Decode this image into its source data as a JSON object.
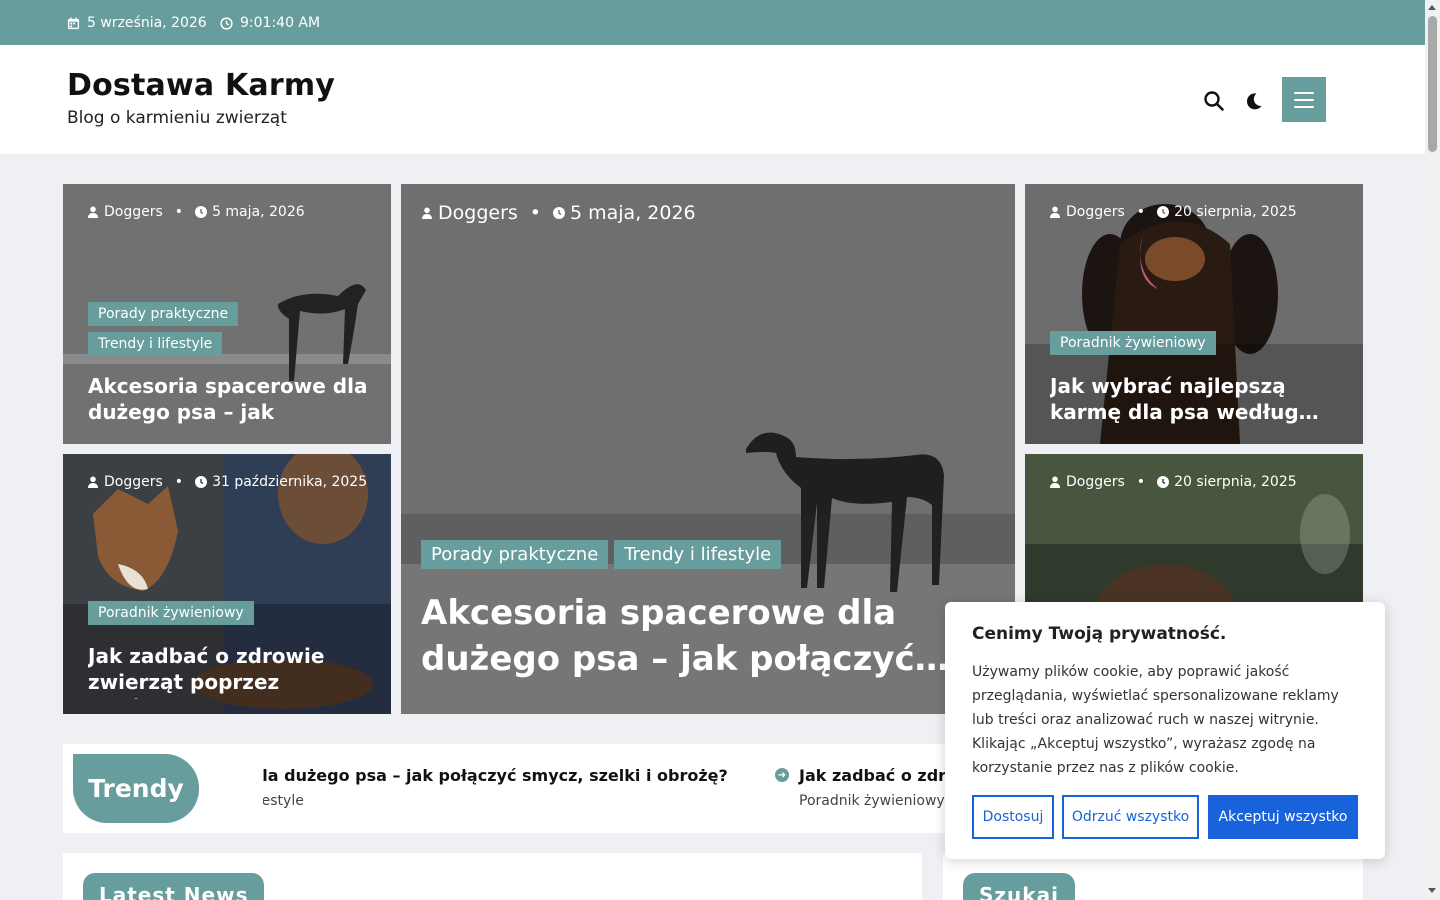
{
  "topbar": {
    "date": "5 września, 2026",
    "time": "9:01:40 AM",
    "icons": [
      "calendar-icon",
      "clock-icon"
    ]
  },
  "header": {
    "site_title": "Dostawa Karmy",
    "tagline": "Blog o karmieniu zwierząt"
  },
  "colors": {
    "accent": "#689d9e",
    "cookie_blue": "#1863dc"
  },
  "cards": [
    {
      "author": "Doggers",
      "date": "5 maja, 2026",
      "cats": [
        "Porady praktyczne",
        "Trendy i lifestyle"
      ],
      "title": "Akcesoria spacerowe dla dużego psa – jak połączy…"
    },
    {
      "author": "Doggers",
      "date": "31 października, 2025",
      "cats": [
        "Poradnik żywieniowy"
      ],
      "title": "Jak zadbać o zdrowie zwierząt poprzez właściw…"
    },
    {
      "author": "Doggers",
      "date": "5 maja, 2026",
      "cats": [
        "Porady praktyczne",
        "Trendy i lifestyle"
      ],
      "title": "Akcesoria spacerowe dla dużego psa – jak połączyć…"
    },
    {
      "author": "Doggers",
      "date": "20 sierpnia, 2025",
      "cats": [
        "Poradnik żywieniowy"
      ],
      "title": "Jak wybrać najlepszą karmę dla psa według…"
    },
    {
      "author": "Doggers",
      "date": "20 sierpnia, 2025",
      "cats": [],
      "title": ""
    }
  ],
  "trending": {
    "label": "Trendy",
    "items": [
      {
        "title": "Akcesoria spacerowe dla dużego psa – jak połączyć smycz, szelki i obrożę?",
        "cat": "Porady praktyczne Trendy i lifestyle"
      },
      {
        "title": "Jak zadbać o zdrowie",
        "cat": "Poradnik żywieniowy"
      }
    ]
  },
  "sections": {
    "latest_news": "Latest News",
    "search": "Szukaj"
  },
  "cookie": {
    "title": "Cenimy Twoją prywatność.",
    "text": "Używamy plików cookie, aby poprawić jakość przeglądania, wyświetlać spersonalizowane reklamy lub treści oraz analizować ruch w naszej witrynie. Klikając „Akceptuj wszystko”, wyrażasz zgodę na korzystanie przez nas z plików cookie.",
    "customize": "Dostosuj",
    "reject": "Odrzuć wszystko",
    "accept": "Akceptuj wszystko"
  }
}
